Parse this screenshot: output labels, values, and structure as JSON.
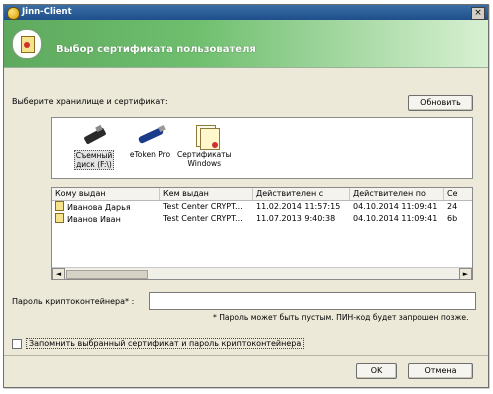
{
  "window": {
    "title": "Jinn-Client",
    "close_glyph": "×"
  },
  "header": {
    "title": "Выбор сертификата пользователя"
  },
  "prompt": "Выберите хранилище и сертификат:",
  "refresh_button": "Обновить",
  "stores": [
    {
      "label_line1": "Съемный",
      "label_line2": "диск (F:\\)",
      "icon": "usb-drive-icon",
      "selected": true
    },
    {
      "label_line1": "eToken Pro",
      "label_line2": "",
      "icon": "etoken-icon",
      "selected": false
    },
    {
      "label_line1": "Сертификаты",
      "label_line2": "Windows",
      "icon": "windows-certificates-icon",
      "selected": false
    }
  ],
  "table": {
    "columns": [
      "Кому выдан",
      "Кем выдан",
      "Действителен с",
      "Действителен по",
      "Се"
    ],
    "rows": [
      {
        "to": "Иванова Дарья",
        "by": "Test Center CRYPT...",
        "from": "11.02.2014 11:57:15",
        "until": "04.10.2014 11:09:41",
        "serial": "24"
      },
      {
        "to": "Иванов Иван",
        "by": "Test Center CRYPT...",
        "from": "11.07.2013 9:40:38",
        "until": "04.10.2014 11:09:41",
        "serial": "6b"
      }
    ],
    "scroll_left": "◄",
    "scroll_right": "►"
  },
  "password": {
    "label": "Пароль криптоконтейнера* :",
    "value": "",
    "hint": "* Пароль может быть пустым. ПИН-код будет запрошен позже."
  },
  "remember": {
    "label": "Запомнить выбранный сертификат и пароль криптоконтейнера",
    "checked": false
  },
  "buttons": {
    "ok": "OK",
    "cancel": "Отмена"
  },
  "colors": {
    "titlebar": "#1f4f8b",
    "header_green": "#5ea95e",
    "dialog_bg": "#ece9d8"
  }
}
